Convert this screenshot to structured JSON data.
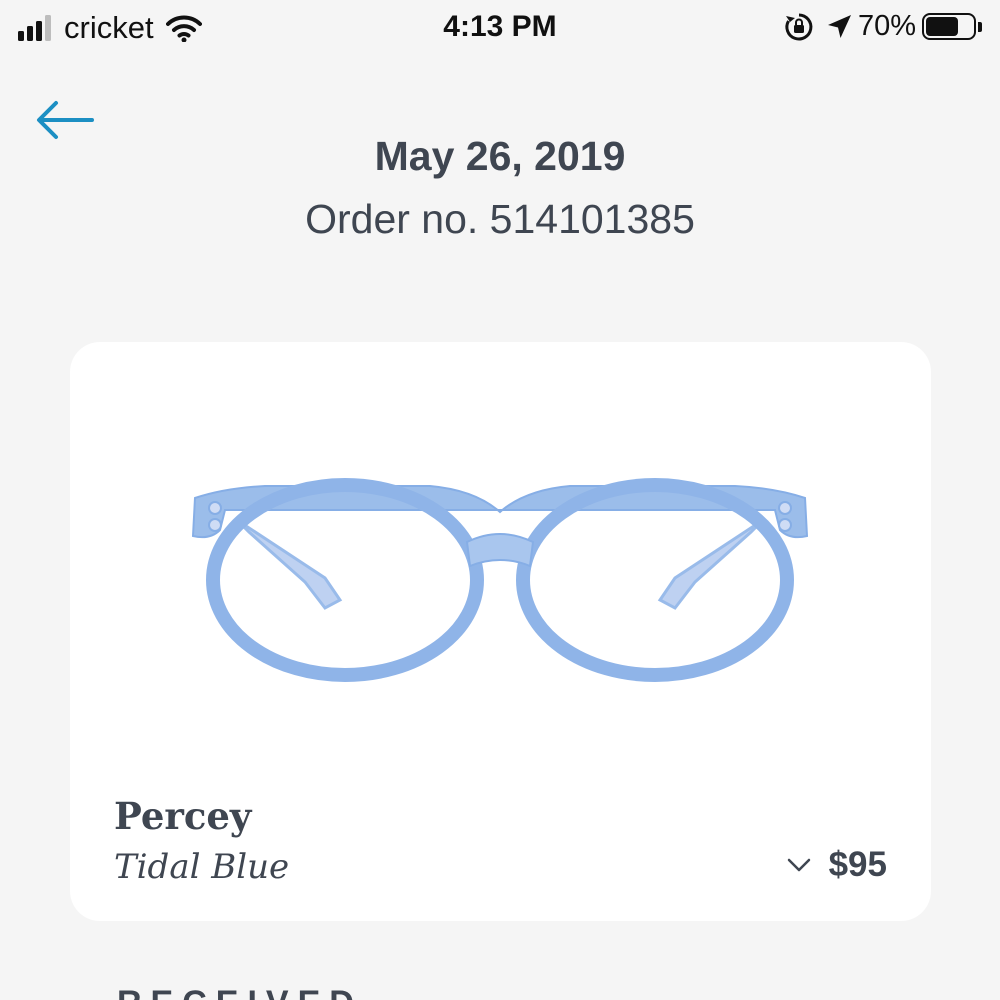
{
  "status_bar": {
    "carrier": "cricket",
    "time": "4:13 PM",
    "battery_percent": "70%",
    "battery_level": 0.7,
    "signal_bars_filled": 3,
    "signal_bars_total": 4
  },
  "header": {
    "back_icon": "arrow-left-icon",
    "date": "May 26, 2019",
    "order_number": "Order no. 514101385"
  },
  "product": {
    "name": "Percey",
    "color": "Tidal Blue",
    "price": "$95",
    "expand_icon": "chevron-down-icon",
    "image": "blue-round-eyeglasses"
  },
  "section": {
    "label": "RECEIVED"
  },
  "colors": {
    "accent": "#1c8fc3",
    "text": "#3f4651",
    "background": "#f5f5f5",
    "card": "#ffffff",
    "frame": "#8fb4e8"
  }
}
